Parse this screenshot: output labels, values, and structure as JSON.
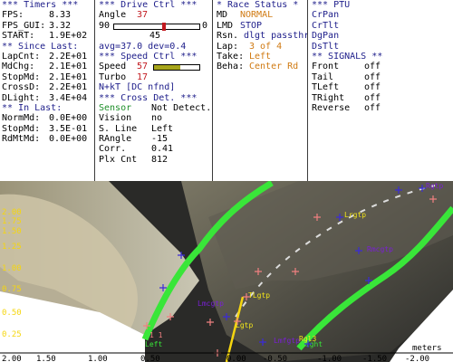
{
  "timers": {
    "header": "*** Timers ***",
    "rows": [
      {
        "label": "FPS:",
        "value": "8.33"
      },
      {
        "label": "FPS_GUI:",
        "value": "3.32"
      },
      {
        "label": "START:",
        "value": "1.9E+02"
      }
    ],
    "since_header": "** Since Last:",
    "since_rows": [
      {
        "label": "LapCnt:",
        "value": "2.2E+01"
      },
      {
        "label": "MdChg:",
        "value": "2.1E+01"
      },
      {
        "label": "StopMd:",
        "value": "2.1E+01"
      },
      {
        "label": "CrossD:",
        "value": "2.2E+01"
      },
      {
        "label": "DLight:",
        "value": "3.4E+04"
      }
    ],
    "in_header": "** In Last:",
    "in_rows": [
      {
        "label": "NormMd:",
        "value": "0.0E+00"
      },
      {
        "label": "StopMd:",
        "value": "3.5E-01"
      },
      {
        "label": "RdMtMd:",
        "value": "0.0E+00"
      }
    ]
  },
  "drive": {
    "header": "***  Drive Ctrl  ***",
    "angle_label": "Angle",
    "angle_value": "37",
    "slider_min": "90",
    "slider_max": "0",
    "slider_level": 0.59,
    "slider_center": "45",
    "avg_text": "avg=37.0  dev=0.4",
    "speed_header": "***  Speed Ctrl  ***",
    "speed_label": "Speed",
    "speed_value": "57",
    "speed_level": 0.57,
    "turbo_label": "Turbo",
    "turbo_value": "17",
    "nokt_text": "N+kT [DC nfnd]",
    "cross_header": "*** Cross Det. ***",
    "sensor_label": "Sensor",
    "sensor_value": "Not Detect.",
    "cross_rows": [
      {
        "label": "Vision",
        "value": "no"
      },
      {
        "label": "S. Line",
        "value": "Left"
      },
      {
        "label": "RAngle",
        "value": "-15"
      },
      {
        "label": "Corr.",
        "value": "0.41"
      },
      {
        "label": "Plx Cnt",
        "value": "812"
      }
    ]
  },
  "race": {
    "header": "* Race Status *",
    "rows": [
      {
        "label": "MD",
        "value": "NORMAL",
        "color": "orange"
      },
      {
        "label": "LMD",
        "value": "STOP",
        "color": "blue"
      },
      {
        "label": "Rsn.",
        "value": "dlgt passthro",
        "color": "blue"
      },
      {
        "label": "Lap:",
        "value": "3 of 4",
        "color": "orange"
      },
      {
        "label": "Take:",
        "value": "Left",
        "color": "orange"
      },
      {
        "label": "Beha:",
        "value": "Center Rd",
        "color": "orange"
      }
    ]
  },
  "ptu": {
    "header": "*** PTU",
    "items": [
      "CrPan",
      "CrTlt",
      "DgPan",
      "DsTlt"
    ],
    "signals_header": "** SIGNALS **",
    "signals": [
      {
        "label": "Front",
        "value": "off"
      },
      {
        "label": "Tail",
        "value": "off"
      },
      {
        "label": "TLeft",
        "value": "off"
      },
      {
        "label": "TRight",
        "value": "off"
      },
      {
        "label": "Reverse",
        "value": "off"
      }
    ]
  },
  "camera": {
    "x_ticks": [
      "2.00",
      "1.50",
      "1.00",
      "0.50",
      "0.00",
      "-0.50",
      "-1.00",
      "-1.50",
      "-2.00"
    ],
    "x_unit": "meters",
    "y_ticks": [
      "2.00",
      "1.75",
      "1.50",
      "1.25",
      "1.00",
      "0.75",
      "0.50",
      "0.25"
    ],
    "labels": {
      "rgtp_top": "Rgtp",
      "lrgtp": "Lrgtp",
      "rmcgtp": "Rmcgtp",
      "tlgtp": "TLgtp",
      "lmcgtp": "Lmcgtp",
      "lgtp": "Lgtp",
      "lmfgtp": "Lmfgtp",
      "rgl3": "Rgl3",
      "left": "Left",
      "right": "Right",
      "pt5": "1 1"
    },
    "colors": {
      "green_line": "#39e639",
      "marker_blue": "#3b2bd8",
      "label_purple": "#7a1fd6",
      "label_yellow": "#f2e41a",
      "label_pink": "#f08080",
      "axis_yellow": "#f5d60f"
    }
  }
}
